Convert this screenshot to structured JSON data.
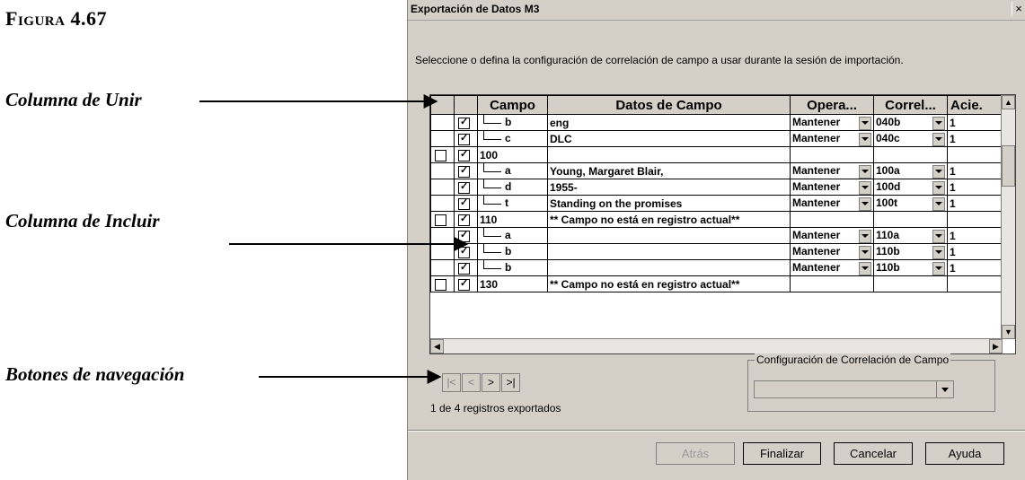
{
  "figure": {
    "title": "Figura 4.67"
  },
  "callouts": {
    "unir": "Columna de Unir",
    "incluir": "Columna de Incluir",
    "nav": "Botones de navegación"
  },
  "dialog": {
    "title": "Exportación de Datos M3",
    "close_glyph": "×",
    "instruction": "Seleccione o defina la configuración de correlación de campo a usar durante la sesión de importación."
  },
  "grid": {
    "columns": [
      "",
      "",
      "Campo",
      "Datos de Campo",
      "Opera...",
      "Correl...",
      "Acie."
    ],
    "rows": [
      {
        "join": false,
        "include": true,
        "tree": true,
        "campo": "b",
        "datos": "eng",
        "op": "Mantener",
        "corr": "040b",
        "acie": "1"
      },
      {
        "join": false,
        "include": true,
        "tree": true,
        "campo": "c",
        "datos": "DLC",
        "op": "Mantener",
        "corr": "040c",
        "acie": "1"
      },
      {
        "join": true,
        "include": true,
        "tree": false,
        "campo": "100",
        "datos": "",
        "op": "",
        "corr": "",
        "acie": ""
      },
      {
        "join": false,
        "include": true,
        "tree": true,
        "campo": "a",
        "datos": "Young, Margaret Blair,",
        "op": "Mantener",
        "corr": "100a",
        "acie": "1"
      },
      {
        "join": false,
        "include": true,
        "tree": true,
        "campo": "d",
        "datos": "1955-",
        "op": "Mantener",
        "corr": "100d",
        "acie": "1"
      },
      {
        "join": false,
        "include": true,
        "tree": true,
        "campo": "t",
        "datos": "Standing on the promises",
        "op": "Mantener",
        "corr": "100t",
        "acie": "1"
      },
      {
        "join": true,
        "include": true,
        "tree": false,
        "campo": "110",
        "datos": "** Campo no está en registro actual**",
        "op": "",
        "corr": "",
        "acie": ""
      },
      {
        "join": false,
        "include": true,
        "tree": true,
        "campo": "a",
        "datos": "",
        "op": "Mantener",
        "corr": "110a",
        "acie": "1"
      },
      {
        "join": false,
        "include": true,
        "tree": true,
        "campo": "b",
        "datos": "",
        "op": "Mantener",
        "corr": "110b",
        "acie": "1"
      },
      {
        "join": false,
        "include": true,
        "tree": true,
        "campo": "b",
        "datos": "",
        "op": "Mantener",
        "corr": "110b",
        "acie": "1"
      },
      {
        "join": true,
        "include": true,
        "tree": false,
        "campo": "130",
        "datos": "** Campo no está en registro actual**",
        "op": "",
        "corr": "",
        "acie": ""
      }
    ]
  },
  "nav": {
    "buttons": [
      "|<",
      "<",
      ">",
      ">|"
    ],
    "status": "1 de 4 registros exportados"
  },
  "config": {
    "label": "Configuración de Correlación de Campo",
    "value": ""
  },
  "buttons": {
    "back": "Atrás",
    "finish": "Finalizar",
    "cancel": "Cancelar",
    "help": "Ayuda"
  }
}
